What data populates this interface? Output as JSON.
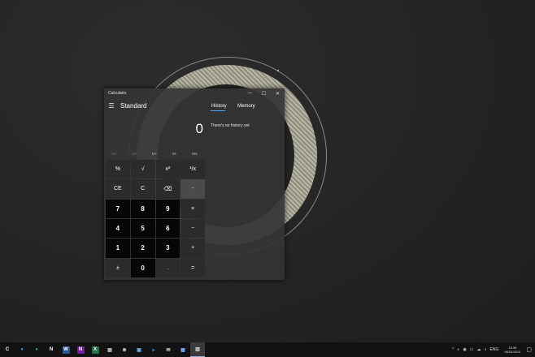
{
  "calculator": {
    "window_title": "Calculator",
    "controls": {
      "minimize": "—",
      "maximize": "☐",
      "close": "✕"
    },
    "menu_icon": "☰",
    "mode_title": "Standard",
    "tabs": {
      "history": "History",
      "memory": "Memory"
    },
    "display_value": "0",
    "history_empty": "There's no history yet",
    "memory_buttons": [
      "MC",
      "MR",
      "M+",
      "M-",
      "MS"
    ],
    "keys": [
      {
        "label": "%",
        "style": "op"
      },
      {
        "label": "√",
        "style": "op"
      },
      {
        "label": "x²",
        "style": "op"
      },
      {
        "label": "¹/x",
        "style": "op"
      },
      {
        "label": "CE",
        "style": "op"
      },
      {
        "label": "C",
        "style": "op"
      },
      {
        "label": "⌫",
        "style": "op"
      },
      {
        "label": "÷",
        "style": "hl"
      },
      {
        "label": "7",
        "style": "num"
      },
      {
        "label": "8",
        "style": "num"
      },
      {
        "label": "9",
        "style": "num"
      },
      {
        "label": "×",
        "style": "op"
      },
      {
        "label": "4",
        "style": "num"
      },
      {
        "label": "5",
        "style": "num"
      },
      {
        "label": "6",
        "style": "num"
      },
      {
        "label": "−",
        "style": "op"
      },
      {
        "label": "1",
        "style": "num"
      },
      {
        "label": "2",
        "style": "num"
      },
      {
        "label": "3",
        "style": "num"
      },
      {
        "label": "+",
        "style": "op"
      },
      {
        "label": "±",
        "style": "op"
      },
      {
        "label": "0",
        "style": "num"
      },
      {
        "label": ".",
        "style": "op"
      },
      {
        "label": "=",
        "style": "op"
      }
    ]
  },
  "taskbar": {
    "apps": [
      {
        "name": "start-icon",
        "glyph": "C",
        "color": "#ffffff",
        "bg": "transparent"
      },
      {
        "name": "browser-icon",
        "glyph": "●",
        "color": "#2f8fe0",
        "bg": "transparent"
      },
      {
        "name": "spotify-icon",
        "glyph": "●",
        "color": "#1db954",
        "bg": "transparent"
      },
      {
        "name": "notion-icon",
        "glyph": "N",
        "color": "#ffffff",
        "bg": "transparent"
      },
      {
        "name": "word-icon",
        "glyph": "W",
        "color": "#ffffff",
        "bg": "#2b579a"
      },
      {
        "name": "onenote-icon",
        "glyph": "N",
        "color": "#ffffff",
        "bg": "#7719aa"
      },
      {
        "name": "excel-icon",
        "glyph": "X",
        "color": "#ffffff",
        "bg": "#217346"
      },
      {
        "name": "document-icon",
        "glyph": "▤",
        "color": "#dddddd",
        "bg": "transparent"
      },
      {
        "name": "xbox-icon",
        "glyph": "⊗",
        "color": "#dddddd",
        "bg": "transparent"
      },
      {
        "name": "photos-icon",
        "glyph": "▣",
        "color": "#6cb4ff",
        "bg": "transparent"
      },
      {
        "name": "remote-icon",
        "glyph": "▸",
        "color": "#2f8fe0",
        "bg": "transparent"
      },
      {
        "name": "mail-icon",
        "glyph": "✉",
        "color": "#dddddd",
        "bg": "transparent"
      },
      {
        "name": "store-icon",
        "glyph": "▦",
        "color": "#6cb4ff",
        "bg": "transparent"
      },
      {
        "name": "calculator-icon",
        "glyph": "▥",
        "color": "#dddddd",
        "bg": "transparent",
        "active": true
      }
    ],
    "tray": [
      "^",
      "◐",
      "◉",
      "▭",
      "☁",
      "◖",
      "ENG"
    ],
    "clock_time": "18:36",
    "clock_date": "06/03/2019",
    "notification_icon": "▢"
  }
}
